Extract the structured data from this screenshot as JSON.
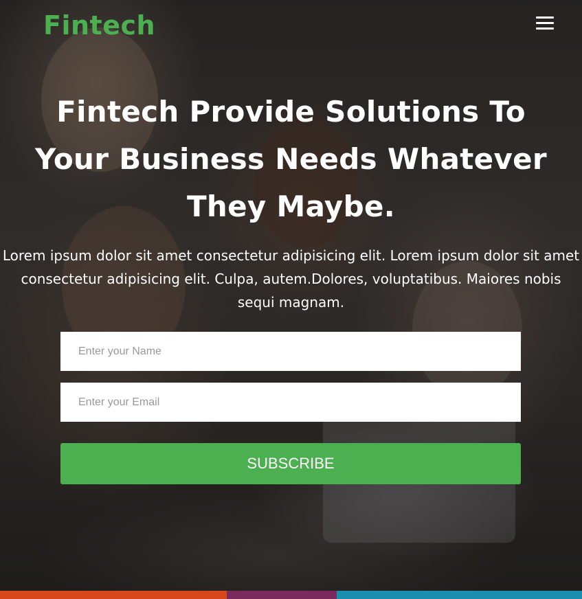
{
  "navbar": {
    "brand": "Fintech",
    "menu_icon": "hamburger-menu-icon"
  },
  "hero": {
    "headline": "Fintech Provide Solutions To Your Business Needs Whatever They Maybe.",
    "subtext": "Lorem ipsum dolor sit amet consectetur adipisicing elit. Lorem ipsum dolor sit amet consectetur adipisicing elit. Culpa, autem.Dolores, voluptatibus. Maiores nobis sequi magnam."
  },
  "form": {
    "name_placeholder": "Enter your Name",
    "email_placeholder": "Enter your Email",
    "subscribe_label": "SUBSCRIBE"
  },
  "colors": {
    "brand_green": "#4caf50",
    "button_green": "#4caf50",
    "text_white": "#ffffff"
  }
}
